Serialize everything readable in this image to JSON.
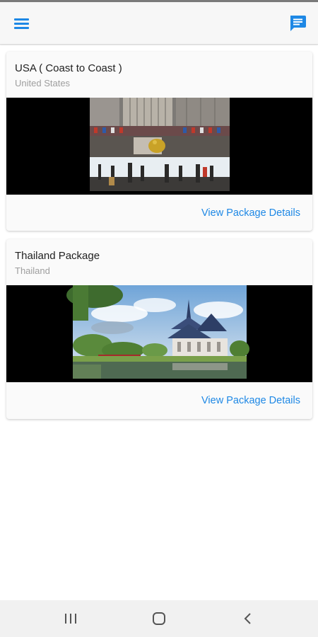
{
  "app": {
    "menu_icon": "hamburger-menu-icon",
    "chat_icon": "chat-message-icon",
    "accent_color": "#1e88e5"
  },
  "packages": [
    {
      "title": "USA ( Coast to Coast )",
      "country": "United States",
      "image": "new-york-rockefeller-center-ice-rink-photo",
      "action": "View Package Details"
    },
    {
      "title": "Thailand Package",
      "country": "Thailand",
      "image": "thailand-temple-by-lake-photo",
      "action": "View Package Details"
    }
  ],
  "system_nav": {
    "recents_icon": "recent-apps-icon",
    "home_icon": "home-icon",
    "back_icon": "back-icon"
  }
}
